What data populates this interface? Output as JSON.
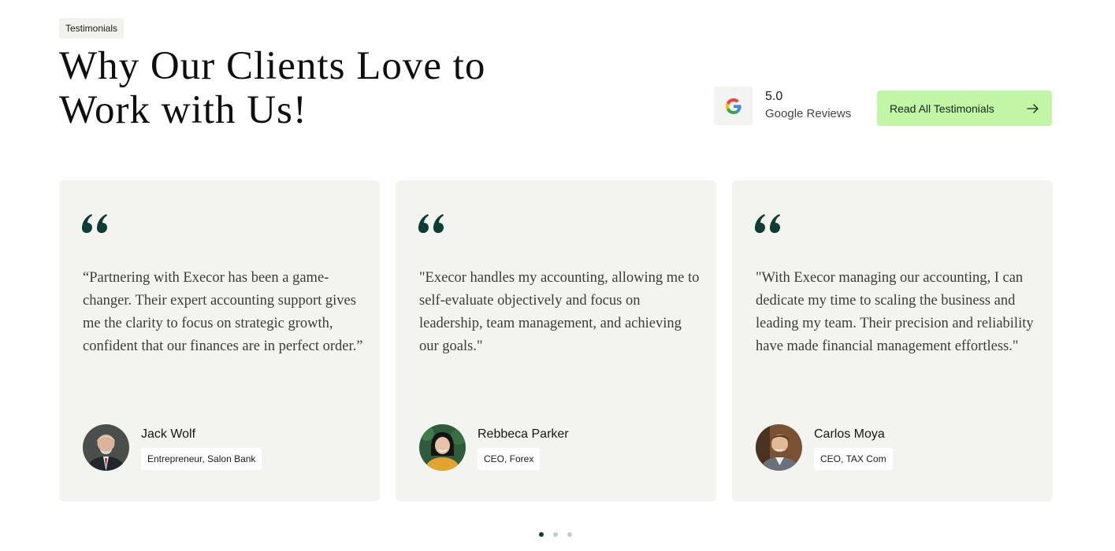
{
  "section": {
    "tag": "Testimonials",
    "title": "Why Our Clients Love to Work with Us!"
  },
  "rating": {
    "icon": "google-logo-icon",
    "value": "5.0",
    "label": "Google Reviews"
  },
  "cta": {
    "label": "Read All Testimonials",
    "icon": "arrow-right-icon"
  },
  "colors": {
    "accent": "#c3f5a6",
    "card_bg": "#f3f4ef",
    "quote_mark": "#0f3d35"
  },
  "testimonials": [
    {
      "quote": "“Partnering with Execor has been a game-changer. Their expert accounting support gives me the clarity to focus on strategic growth, confident that our finances are in perfect order.”",
      "name": "Jack Wolf",
      "role": "Entrepreneur, Salon Bank"
    },
    {
      "quote": "\"Execor handles my accounting, allowing me to self-evaluate objectively and focus on leadership, team management, and achieving our goals.\"",
      "name": "Rebbeca Parker",
      "role": "CEO, Forex"
    },
    {
      "quote": "\"With Execor managing our accounting, I can dedicate my time to scaling the business and leading my team. Their precision and reliability have made financial management effortless.\"",
      "name": "Carlos Moya",
      "role": "CEO, TAX Com"
    }
  ],
  "pagination": {
    "total": 3,
    "active": 1
  }
}
